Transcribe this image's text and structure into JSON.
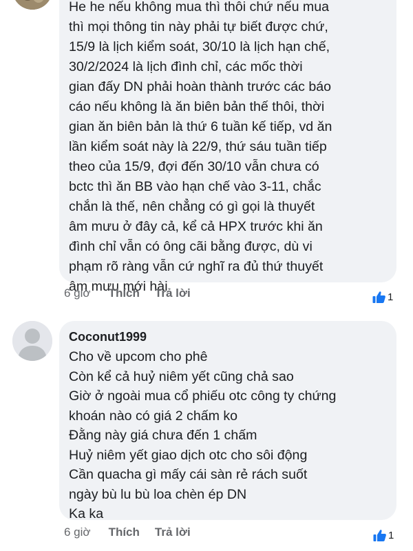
{
  "comments": [
    {
      "author": "",
      "lines": "He he nếu không mua thì thôi chứ nếu mua\nthì mọi thông tin này phải tự biết được chứ,\n15/9 là lịch kiểm soát, 30/10 là lịch hạn chế,\n30/2/2024 là lịch đình chỉ, các mốc thời\ngian đấy DN phải hoàn thành trước các báo\ncáo nếu không là ăn biên bản thế thôi, thời\ngian ăn biên bản là thứ 6 tuần kế tiếp, vd ăn\nlần kiểm soát này là 22/9, thứ sáu tuần tiếp\ntheo của 15/9, đợi đến 30/10 vẫn chưa có\nbctc thì ăn BB vào hạn chế vào 3-11, chắc\nchắn là thế, nên chẳng có gì gọi là thuyết\nâm mưu ở đây cả, kể cả HPX trước khi ăn\nđình chỉ vẫn có ông cãi bằng được, dù vi\nphạm rõ ràng vẫn cứ nghĩ ra đủ thứ thuyết\nâm mưu mới hài",
      "time": "6 giờ",
      "like_label": "Thích",
      "reply_label": "Trả lời",
      "reaction_count": "1",
      "reaction_icon": "thumbs-up-icon"
    },
    {
      "author": "Coconut1999",
      "lines": "Cho về upcom cho phê\nCòn kể cả huỷ niêm yết cũng chả sao\nGiờ ở ngoài mua cổ phiếu otc công ty chứng\nkhoán nào có giá 2 chấm ko\nĐằng này giá chưa đến 1 chấm\nHuỷ niêm yết giao dịch otc cho sôi động\nCần quacha gì mấy cái sàn rẻ rách suốt\nngày bù lu bù loa chèn ép DN\nKa ka",
      "time": "6 giờ",
      "like_label": "Thích",
      "reply_label": "Trả lời",
      "reaction_count": "1",
      "reaction_icon": "thumbs-up-icon"
    }
  ],
  "colors": {
    "bubble": "#f0f2f5",
    "text": "#1c1e21",
    "meta": "#65676b",
    "like_blue": "#1877f2"
  }
}
